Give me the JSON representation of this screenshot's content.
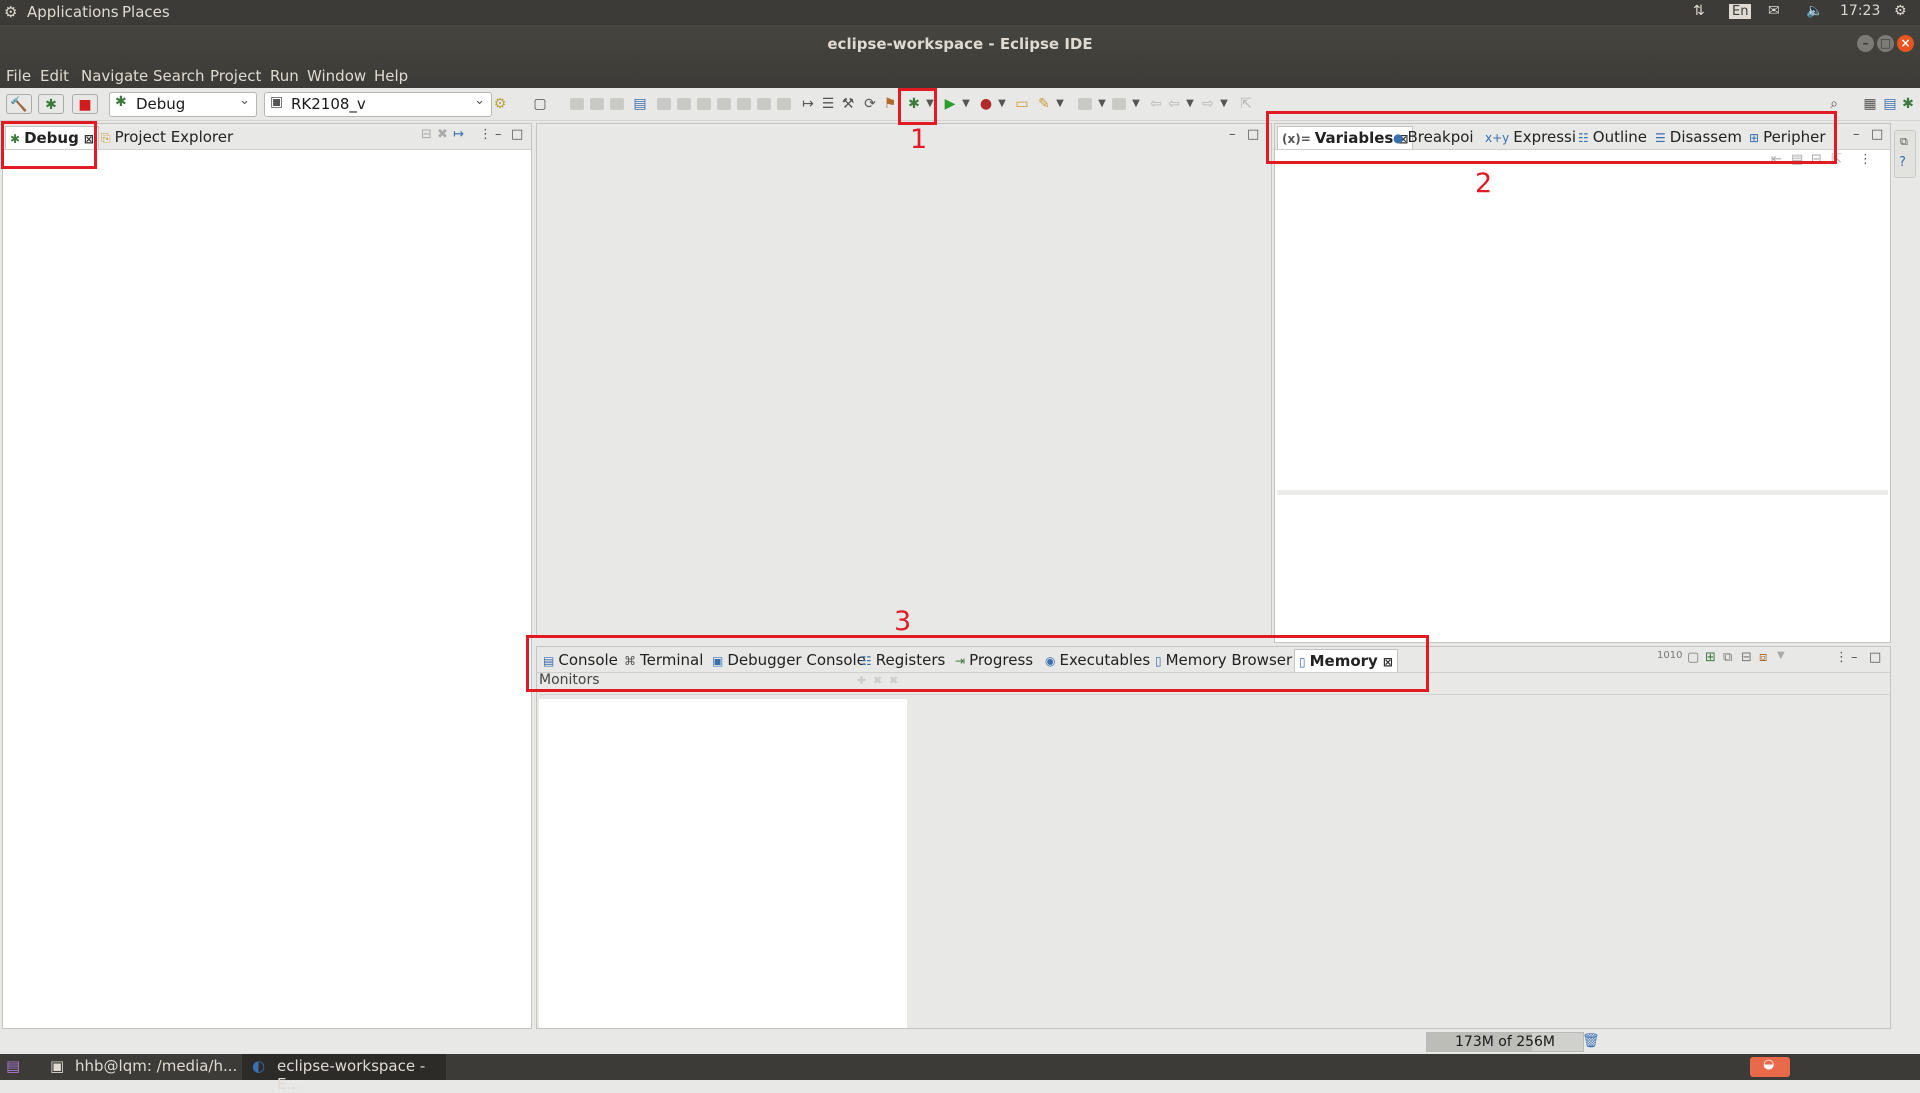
{
  "topbar": {
    "applications": "Applications",
    "places": "Places",
    "lang": "En",
    "time": "17:23"
  },
  "window": {
    "title": "eclipse-workspace - Eclipse IDE"
  },
  "menu": [
    "File",
    "Edit",
    "Navigate",
    "Search",
    "Project",
    "Run",
    "Window",
    "Help"
  ],
  "toolbar": {
    "launch_mode": "Debug",
    "launch_config": "RK2108_v"
  },
  "left_panel": {
    "tabs": [
      "Debug",
      "Project Explorer"
    ]
  },
  "right_panel": {
    "tabs": [
      "Variables",
      "Breakpoi",
      "Expressi",
      "Outline",
      "Disassem",
      "Peripher"
    ]
  },
  "bottom_panel": {
    "tabs": [
      "Console",
      "Terminal",
      "Debugger Console",
      "Registers",
      "Progress",
      "Executables",
      "Memory Browser",
      "Memory"
    ],
    "monitors_label": "Monitors"
  },
  "annotations": [
    "1",
    "2",
    "3"
  ],
  "status": {
    "heap": "173M of 256M",
    "heap_used_fraction": 0.676
  },
  "taskbar": {
    "terminal": "hhb@lqm: /media/h...",
    "eclipse": "eclipse-workspace - E..."
  },
  "colors": {
    "annotation": "#e01b24",
    "chrome": "#3c3b37"
  }
}
